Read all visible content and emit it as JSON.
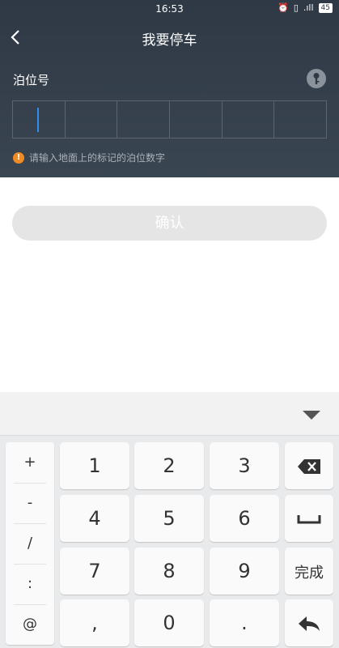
{
  "status_bar": {
    "time": "16:53",
    "alarm_icon": "alarm-icon",
    "vibrate_icon": "vibrate-icon",
    "signal": ".ıll",
    "battery": "45"
  },
  "nav": {
    "back_icon": "back-chevron-icon",
    "title": "我要停车"
  },
  "form": {
    "label": "泊位号",
    "key_icon": "key-icon",
    "box_count": 6,
    "hint_icon": "warning-icon",
    "hint_text": "请输入地面上的标记的泊位数字"
  },
  "confirm_label": "确认",
  "keyboard": {
    "collapse_icon": "chevron-down-icon",
    "symbols": [
      "+",
      "-",
      "/",
      ":",
      "@"
    ],
    "keys": {
      "k1": "1",
      "k2": "2",
      "k3": "3",
      "k4": "4",
      "k5": "5",
      "k6": "6",
      "k7": "7",
      "k8": "8",
      "k9": "9",
      "comma": ",",
      "k0": "0",
      "dot": ".",
      "done": "完成"
    },
    "backspace_icon": "backspace-icon",
    "space_icon": "space-icon",
    "enter_icon": "enter-icon"
  }
}
